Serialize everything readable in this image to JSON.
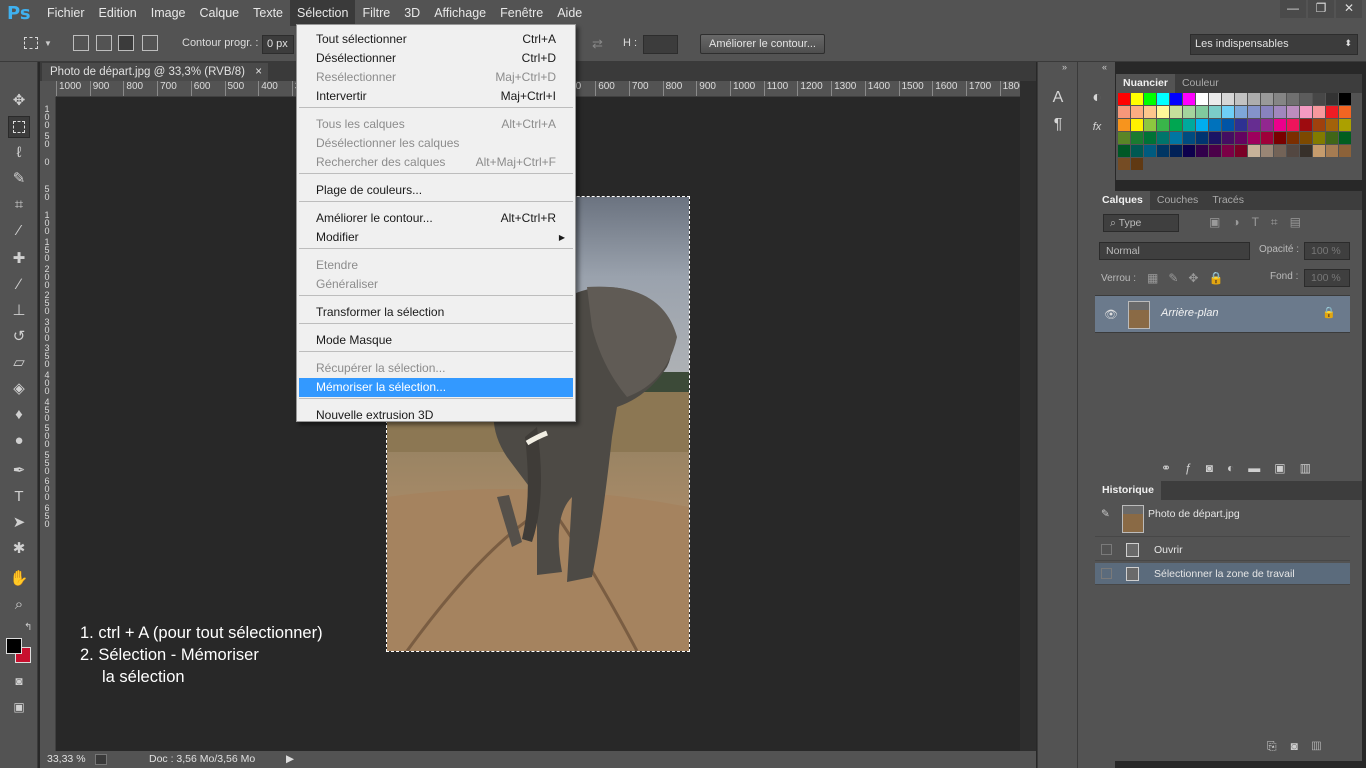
{
  "menubar": {
    "logo": "Ps",
    "items": [
      "Fichier",
      "Edition",
      "Image",
      "Calque",
      "Texte",
      "Sélection",
      "Filtre",
      "3D",
      "Affichage",
      "Fenêtre",
      "Aide"
    ],
    "active": "Sélection"
  },
  "window_controls": [
    "—",
    "❐",
    "✕"
  ],
  "options": {
    "feather_label": "Contour progr. :",
    "feather_value": "0 px",
    "h_label": "H :",
    "refine_button": "Améliorer le contour...",
    "workspace": "Les indispensables"
  },
  "document": {
    "tab_title": "Photo de départ.jpg @ 33,3% (RVB/8)",
    "close": "×",
    "zoom": "33,33 %",
    "doc_size": "Doc : 3,56 Mo/3,56 Mo"
  },
  "ruler": {
    "top": [
      "1000",
      "900",
      "800",
      "700",
      "600",
      "500",
      "400",
      "300",
      "200",
      "100",
      "0",
      "100",
      "200",
      "300",
      "400",
      "500",
      "600",
      "700",
      "800",
      "900",
      "1000",
      "1100",
      "1200",
      "1300",
      "1400",
      "1500",
      "1600",
      "1700",
      "1800"
    ],
    "left": [
      "1\n0\n0",
      "5\n0",
      "0",
      "5\n0",
      "1\n0\n0",
      "1\n5\n0",
      "2\n0\n0",
      "2\n5\n0",
      "3\n0\n0",
      "3\n5\n0",
      "4\n0\n0",
      "4\n5\n0",
      "5\n0\n0",
      "5\n5\n0",
      "6\n0\n0",
      "6\n5\n0"
    ]
  },
  "selection_menu": {
    "items": [
      {
        "label": "Tout sélectionner",
        "shortcut": "Ctrl+A",
        "enabled": true
      },
      {
        "label": "Désélectionner",
        "shortcut": "Ctrl+D",
        "enabled": true
      },
      {
        "label": "Resélectionner",
        "shortcut": "Maj+Ctrl+D",
        "enabled": false
      },
      {
        "label": "Intervertir",
        "shortcut": "Maj+Ctrl+I",
        "enabled": true
      },
      {
        "label": "Tous les calques",
        "shortcut": "Alt+Ctrl+A",
        "enabled": false
      },
      {
        "label": "Désélectionner les calques",
        "shortcut": "",
        "enabled": false
      },
      {
        "label": "Rechercher des calques",
        "shortcut": "Alt+Maj+Ctrl+F",
        "enabled": false
      },
      {
        "label": "Plage de couleurs...",
        "shortcut": "",
        "enabled": true
      },
      {
        "label": "Améliorer le contour...",
        "shortcut": "Alt+Ctrl+R",
        "enabled": true
      },
      {
        "label": "Modifier",
        "shortcut": "",
        "enabled": true,
        "submenu": true
      },
      {
        "label": "Etendre",
        "shortcut": "",
        "enabled": false
      },
      {
        "label": "Généraliser",
        "shortcut": "",
        "enabled": false
      },
      {
        "label": "Transformer la sélection",
        "shortcut": "",
        "enabled": true
      },
      {
        "label": "Mode Masque",
        "shortcut": "",
        "enabled": true
      },
      {
        "label": "Récupérer la sélection...",
        "shortcut": "",
        "enabled": false
      },
      {
        "label": "Mémoriser la sélection...",
        "shortcut": "",
        "enabled": true,
        "highlighted": true
      },
      {
        "label": "Nouvelle extrusion 3D",
        "shortcut": "",
        "enabled": true
      }
    ]
  },
  "annotation": {
    "line1": "1. ctrl + A (pour tout sélectionner)",
    "line2": "2. Sélection - Mémoriser",
    "line3": "la sélection"
  },
  "swatches_panel": {
    "tabs": [
      "Nuancier",
      "Couleur"
    ],
    "colors": [
      "#ff0000",
      "#ffff00",
      "#00ff00",
      "#00ffff",
      "#0000ff",
      "#ff00ff",
      "#ffffff",
      "#ebebeb",
      "#d6d6d6",
      "#c2c2c2",
      "#adadad",
      "#999999",
      "#858585",
      "#707070",
      "#5c5c5c",
      "#474747",
      "#333333",
      "#000000",
      "#f7977a",
      "#fbad82",
      "#fdc68c",
      "#fff799",
      "#c6df9c",
      "#a4d49d",
      "#81ca9d",
      "#7bcdc8",
      "#6ecff6",
      "#7ea7d8",
      "#8493ca",
      "#8882be",
      "#a187be",
      "#bc8dbf",
      "#f49ac2",
      "#f6989d",
      "#ed1c24",
      "#f26522",
      "#f7941d",
      "#fff200",
      "#8dc73f",
      "#39b54a",
      "#00a651",
      "#00a99d",
      "#00aeef",
      "#0072bc",
      "#0054a6",
      "#2e3192",
      "#662d91",
      "#92278f",
      "#ec008c",
      "#ed145b",
      "#9e0b0f",
      "#a0410d",
      "#a3620a",
      "#aba000",
      "#598527",
      "#1a7b30",
      "#007236",
      "#00746b",
      "#0076a3",
      "#004b80",
      "#003471",
      "#1b1464",
      "#440e62",
      "#630460",
      "#9e005d",
      "#9e0039",
      "#790000",
      "#7b2e00",
      "#7d4900",
      "#827b00",
      "#406618",
      "#005e20",
      "#005826",
      "#005952",
      "#005b7f",
      "#003663",
      "#002157",
      "#0d004c",
      "#32004b",
      "#4b0049",
      "#7b0046",
      "#7a0026",
      "#c7b299",
      "#998675",
      "#736357",
      "#534741",
      "#37302a",
      "#c69c6d",
      "#a67c52",
      "#8c6239",
      "#754c24",
      "#603913"
    ]
  },
  "layers_panel": {
    "tabs": [
      "Calques",
      "Couches",
      "Tracés"
    ],
    "filter": "Type",
    "blend_mode": "Normal",
    "opacity_label": "Opacité :",
    "opacity_value": "100 %",
    "lock_label": "Verrou :",
    "fill_label": "Fond :",
    "fill_value": "100 %",
    "layer_name": "Arrière-plan"
  },
  "history_panel": {
    "tab": "Historique",
    "snapshot": "Photo de départ.jpg",
    "steps": [
      "Ouvrir",
      "Sélectionner la zone de travail"
    ]
  },
  "colors": {
    "menu_highlight": "#3399ff",
    "foreground": "#000000",
    "background": "#c8102e"
  }
}
